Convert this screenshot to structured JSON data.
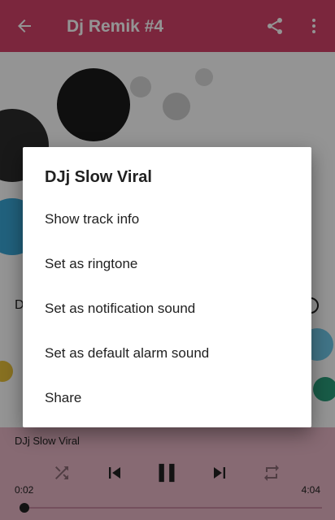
{
  "toolbar": {
    "title": "Dj Remik #4",
    "back_icon": "arrow-left-icon",
    "share_icon": "share-icon",
    "more_icon": "more-vertical-icon",
    "color": "#d4436a"
  },
  "background_list": {
    "row_label": "D"
  },
  "dialog": {
    "title": "DJj Slow Viral",
    "items": [
      "Show track info",
      "Set as ringtone",
      "Set as notification sound",
      "Set as default alarm sound",
      "Share"
    ]
  },
  "player": {
    "now_playing": "DJj Slow Viral",
    "elapsed": "0:02",
    "duration": "4:04",
    "progress": 0.01,
    "shuffle_icon": "shuffle-icon",
    "previous_icon": "skip-previous-icon",
    "pause_icon": "pause-icon",
    "next_icon": "skip-next-icon",
    "repeat_icon": "repeat-icon",
    "color": "#e9b7c6"
  }
}
